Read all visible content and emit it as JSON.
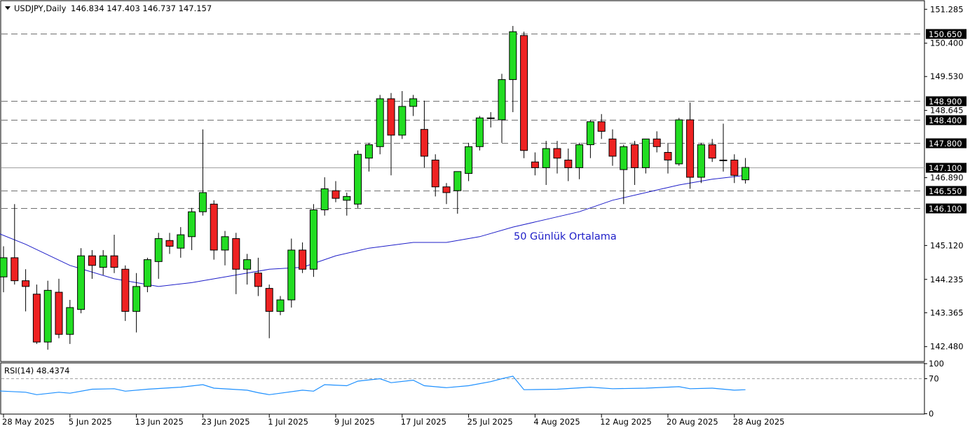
{
  "chart_data": [
    {
      "type": "candlestick",
      "symbol_header": "USDJPY,Daily",
      "ohlc_header": "146.834 147.403 146.737 147.157",
      "y_axis_ticks": [
        "151.285",
        "150.400",
        "149.530",
        "148.645",
        "146.890",
        "145.120",
        "144.235",
        "143.365",
        "142.480"
      ],
      "ylim": [
        142.1,
        151.5
      ],
      "x_tick_labels": [
        {
          "i": 0,
          "label": "28 May 2025"
        },
        {
          "i": 6,
          "label": "5 Jun 2025"
        },
        {
          "i": 12,
          "label": "13 Jun 2025"
        },
        {
          "i": 18,
          "label": "23 Jun 2025"
        },
        {
          "i": 24,
          "label": "1 Jul 2025"
        },
        {
          "i": 30,
          "label": "9 Jul 2025"
        },
        {
          "i": 36,
          "label": "17 Jul 2025"
        },
        {
          "i": 42,
          "label": "25 Jul 2025"
        },
        {
          "i": 48,
          "label": "4 Aug 2025"
        },
        {
          "i": 54,
          "label": "12 Aug 2025"
        },
        {
          "i": 60,
          "label": "20 Aug 2025"
        },
        {
          "i": 66,
          "label": "28 Aug 2025"
        }
      ],
      "horizontal_levels": [
        {
          "value": 150.65,
          "label": "150.650"
        },
        {
          "value": 148.9,
          "label": "148.900"
        },
        {
          "value": 148.4,
          "label": "148.400"
        },
        {
          "value": 147.8,
          "label": "147.800"
        },
        {
          "value": 146.55,
          "label": "146.550"
        },
        {
          "value": 146.1,
          "label": "146.100"
        }
      ],
      "current_price_label": "147.100",
      "current_price": 147.157,
      "ma_label": "50 Günlük Ortalama",
      "ma_color": "#1e1ec8",
      "up_color": "#22dd22",
      "down_color": "#ee2222",
      "candles": [
        {
          "o": 144.3,
          "h": 145.1,
          "l": 143.9,
          "c": 144.8
        },
        {
          "o": 144.8,
          "h": 146.2,
          "l": 144.1,
          "c": 144.2
        },
        {
          "o": 144.2,
          "h": 144.5,
          "l": 143.4,
          "c": 144.05
        },
        {
          "o": 143.85,
          "h": 144.1,
          "l": 142.55,
          "c": 142.6
        },
        {
          "o": 142.6,
          "h": 144.2,
          "l": 142.4,
          "c": 143.95
        },
        {
          "o": 143.9,
          "h": 144.25,
          "l": 142.7,
          "c": 142.8
        },
        {
          "o": 142.8,
          "h": 143.7,
          "l": 142.55,
          "c": 143.5
        },
        {
          "o": 143.45,
          "h": 145.05,
          "l": 143.35,
          "c": 144.85
        },
        {
          "o": 144.85,
          "h": 145.0,
          "l": 144.25,
          "c": 144.6
        },
        {
          "o": 144.55,
          "h": 145.0,
          "l": 144.35,
          "c": 144.85
        },
        {
          "o": 144.85,
          "h": 145.4,
          "l": 144.4,
          "c": 144.55
        },
        {
          "o": 144.5,
          "h": 144.6,
          "l": 143.15,
          "c": 143.4
        },
        {
          "o": 143.4,
          "h": 144.4,
          "l": 142.85,
          "c": 144.05
        },
        {
          "o": 144.05,
          "h": 144.8,
          "l": 143.9,
          "c": 144.75
        },
        {
          "o": 144.7,
          "h": 145.45,
          "l": 144.25,
          "c": 145.3
        },
        {
          "o": 145.25,
          "h": 145.45,
          "l": 144.9,
          "c": 145.1
        },
        {
          "o": 145.05,
          "h": 145.6,
          "l": 144.8,
          "c": 145.4
        },
        {
          "o": 145.35,
          "h": 146.1,
          "l": 145.0,
          "c": 146.0
        },
        {
          "o": 146.0,
          "h": 148.15,
          "l": 145.9,
          "c": 146.5
        },
        {
          "o": 146.2,
          "h": 146.3,
          "l": 144.75,
          "c": 145.0
        },
        {
          "o": 145.0,
          "h": 145.5,
          "l": 144.6,
          "c": 145.35
        },
        {
          "o": 145.3,
          "h": 145.45,
          "l": 143.85,
          "c": 144.5
        },
        {
          "o": 144.5,
          "h": 144.9,
          "l": 144.1,
          "c": 144.75
        },
        {
          "o": 144.4,
          "h": 144.8,
          "l": 143.8,
          "c": 144.05
        },
        {
          "o": 144.0,
          "h": 144.1,
          "l": 142.7,
          "c": 143.4
        },
        {
          "o": 143.4,
          "h": 143.8,
          "l": 143.3,
          "c": 143.7
        },
        {
          "o": 143.7,
          "h": 145.3,
          "l": 143.5,
          "c": 145.0
        },
        {
          "o": 145.0,
          "h": 145.2,
          "l": 144.4,
          "c": 144.5
        },
        {
          "o": 144.5,
          "h": 146.2,
          "l": 144.3,
          "c": 146.05
        },
        {
          "o": 146.05,
          "h": 146.9,
          "l": 145.9,
          "c": 146.6
        },
        {
          "o": 146.55,
          "h": 146.8,
          "l": 146.25,
          "c": 146.35
        },
        {
          "o": 146.3,
          "h": 146.5,
          "l": 145.9,
          "c": 146.4
        },
        {
          "o": 146.2,
          "h": 147.6,
          "l": 146.1,
          "c": 147.5
        },
        {
          "o": 147.4,
          "h": 147.8,
          "l": 147.05,
          "c": 147.75
        },
        {
          "o": 147.7,
          "h": 149.05,
          "l": 147.5,
          "c": 148.95
        },
        {
          "o": 148.95,
          "h": 149.1,
          "l": 146.95,
          "c": 148.0
        },
        {
          "o": 148.0,
          "h": 149.15,
          "l": 147.9,
          "c": 148.75
        },
        {
          "o": 148.75,
          "h": 149.05,
          "l": 148.5,
          "c": 148.95
        },
        {
          "o": 148.15,
          "h": 148.9,
          "l": 147.15,
          "c": 147.45
        },
        {
          "o": 147.35,
          "h": 147.5,
          "l": 146.4,
          "c": 146.65
        },
        {
          "o": 146.65,
          "h": 146.75,
          "l": 146.2,
          "c": 146.5
        },
        {
          "o": 146.55,
          "h": 147.05,
          "l": 145.95,
          "c": 147.05
        },
        {
          "o": 147.0,
          "h": 147.8,
          "l": 146.8,
          "c": 147.7
        },
        {
          "o": 147.7,
          "h": 148.5,
          "l": 147.6,
          "c": 148.45
        },
        {
          "o": 148.45,
          "h": 148.6,
          "l": 148.2,
          "c": 148.45
        },
        {
          "o": 148.4,
          "h": 149.6,
          "l": 147.8,
          "c": 149.45
        },
        {
          "o": 149.45,
          "h": 150.85,
          "l": 148.6,
          "c": 150.7
        },
        {
          "o": 150.6,
          "h": 150.7,
          "l": 147.4,
          "c": 147.6
        },
        {
          "o": 147.3,
          "h": 147.55,
          "l": 146.95,
          "c": 147.15
        },
        {
          "o": 147.15,
          "h": 147.85,
          "l": 146.7,
          "c": 147.65
        },
        {
          "o": 147.65,
          "h": 147.85,
          "l": 147.0,
          "c": 147.4
        },
        {
          "o": 147.35,
          "h": 147.65,
          "l": 146.8,
          "c": 147.15
        },
        {
          "o": 147.15,
          "h": 147.8,
          "l": 146.85,
          "c": 147.75
        },
        {
          "o": 147.75,
          "h": 148.4,
          "l": 147.4,
          "c": 148.35
        },
        {
          "o": 148.35,
          "h": 148.55,
          "l": 147.9,
          "c": 148.1
        },
        {
          "o": 147.9,
          "h": 148.15,
          "l": 147.2,
          "c": 147.45
        },
        {
          "o": 147.1,
          "h": 147.75,
          "l": 146.2,
          "c": 147.7
        },
        {
          "o": 147.75,
          "h": 147.85,
          "l": 146.7,
          "c": 147.15
        },
        {
          "o": 147.15,
          "h": 147.9,
          "l": 147.0,
          "c": 147.9
        },
        {
          "o": 147.9,
          "h": 148.1,
          "l": 147.55,
          "c": 147.7
        },
        {
          "o": 147.55,
          "h": 147.8,
          "l": 147.0,
          "c": 147.35
        },
        {
          "o": 147.25,
          "h": 148.45,
          "l": 147.2,
          "c": 148.4
        },
        {
          "o": 148.4,
          "h": 148.85,
          "l": 146.6,
          "c": 146.9
        },
        {
          "o": 146.9,
          "h": 147.8,
          "l": 146.75,
          "c": 147.75
        },
        {
          "o": 147.75,
          "h": 147.9,
          "l": 147.3,
          "c": 147.4
        },
        {
          "o": 147.35,
          "h": 148.3,
          "l": 147.05,
          "c": 147.35
        },
        {
          "o": 147.35,
          "h": 147.5,
          "l": 146.75,
          "c": 146.95
        },
        {
          "o": 146.834,
          "h": 147.403,
          "l": 146.737,
          "c": 147.157
        }
      ],
      "moving_average": [
        {
          "i": -1,
          "v": 145.5
        },
        {
          "i": 2,
          "v": 145.15
        },
        {
          "i": 6,
          "v": 144.6
        },
        {
          "i": 10,
          "v": 144.25
        },
        {
          "i": 14,
          "v": 144.05
        },
        {
          "i": 17,
          "v": 144.15
        },
        {
          "i": 21,
          "v": 144.35
        },
        {
          "i": 24,
          "v": 144.5
        },
        {
          "i": 27,
          "v": 144.55
        },
        {
          "i": 30,
          "v": 144.85
        },
        {
          "i": 33,
          "v": 145.05
        },
        {
          "i": 37,
          "v": 145.2
        },
        {
          "i": 40,
          "v": 145.2
        },
        {
          "i": 43,
          "v": 145.35
        },
        {
          "i": 46,
          "v": 145.6
        },
        {
          "i": 49,
          "v": 145.8
        },
        {
          "i": 52,
          "v": 146.0
        },
        {
          "i": 55,
          "v": 146.3
        },
        {
          "i": 58,
          "v": 146.5
        },
        {
          "i": 61,
          "v": 146.7
        },
        {
          "i": 64,
          "v": 146.85
        },
        {
          "i": 67,
          "v": 146.95
        }
      ]
    },
    {
      "type": "line",
      "label": "RSI(14) 48.4374",
      "y_ticks": [
        "100",
        "70",
        "0"
      ],
      "ylim": [
        0,
        100
      ],
      "level": 70,
      "color": "#1e90ff",
      "values": [
        {
          "i": -1,
          "v": 46
        },
        {
          "i": 0,
          "v": 45
        },
        {
          "i": 2,
          "v": 43
        },
        {
          "i": 3,
          "v": 38
        },
        {
          "i": 5,
          "v": 43
        },
        {
          "i": 6,
          "v": 41
        },
        {
          "i": 8,
          "v": 49
        },
        {
          "i": 10,
          "v": 50
        },
        {
          "i": 11,
          "v": 45
        },
        {
          "i": 13,
          "v": 49
        },
        {
          "i": 16,
          "v": 53
        },
        {
          "i": 18,
          "v": 58
        },
        {
          "i": 19,
          "v": 51
        },
        {
          "i": 22,
          "v": 47
        },
        {
          "i": 23,
          "v": 42
        },
        {
          "i": 24,
          "v": 38
        },
        {
          "i": 25,
          "v": 41
        },
        {
          "i": 27,
          "v": 47
        },
        {
          "i": 28,
          "v": 45
        },
        {
          "i": 29,
          "v": 58
        },
        {
          "i": 31,
          "v": 56
        },
        {
          "i": 32,
          "v": 65
        },
        {
          "i": 34,
          "v": 70
        },
        {
          "i": 35,
          "v": 62
        },
        {
          "i": 37,
          "v": 67
        },
        {
          "i": 38,
          "v": 56
        },
        {
          "i": 40,
          "v": 52
        },
        {
          "i": 42,
          "v": 56
        },
        {
          "i": 44,
          "v": 64
        },
        {
          "i": 45,
          "v": 70
        },
        {
          "i": 46,
          "v": 75
        },
        {
          "i": 47,
          "v": 48
        },
        {
          "i": 50,
          "v": 49
        },
        {
          "i": 53,
          "v": 53
        },
        {
          "i": 55,
          "v": 50
        },
        {
          "i": 58,
          "v": 51
        },
        {
          "i": 61,
          "v": 54
        },
        {
          "i": 62,
          "v": 50
        },
        {
          "i": 64,
          "v": 51
        },
        {
          "i": 66,
          "v": 47
        },
        {
          "i": 67,
          "v": 48
        }
      ]
    }
  ]
}
